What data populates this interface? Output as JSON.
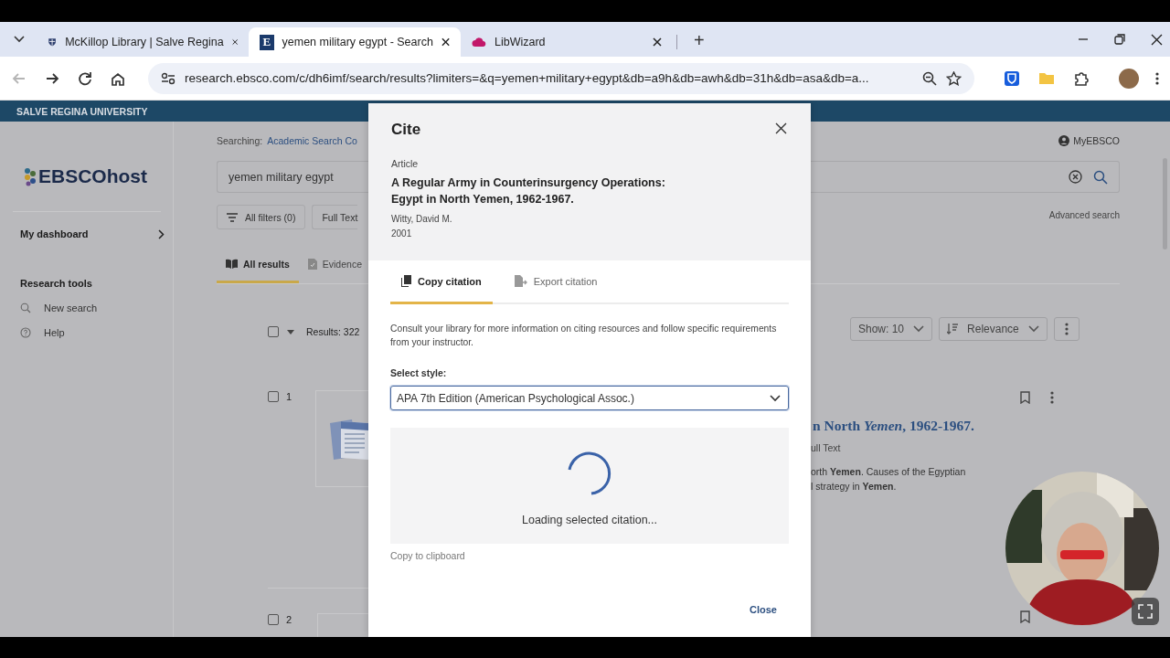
{
  "browser": {
    "tabs": [
      {
        "title": "McKillop Library | Salve Regina",
        "selected": false,
        "kind": "shield"
      },
      {
        "title": "yemen military egypt - Search",
        "selected": true,
        "kind": "letter",
        "favicon": "E"
      },
      {
        "title": "LibWizard",
        "selected": false,
        "kind": "cloud"
      }
    ],
    "new_tab": "+",
    "nav_buttons": [
      {
        "kind": "back",
        "disabled": true
      },
      {
        "kind": "forward",
        "disabled": false
      },
      {
        "kind": "reload",
        "disabled": false
      },
      {
        "kind": "home",
        "disabled": false
      }
    ],
    "url": "research.ebsco.com/c/dh6imf/search/results?limiters=&q=yemen+military+egypt&db=a9h&db=awh&db=31h&db=asa&db=a...",
    "extensions": [
      {
        "kind": "shield"
      },
      {
        "kind": "folder"
      },
      {
        "kind": "puzzle"
      }
    ]
  },
  "page": {
    "banner": "SALVE REGINA UNIVERSITY",
    "sidebar": {
      "logo": "EBSCOhost",
      "dashboard": "My dashboard",
      "section_title": "Research tools",
      "items": [
        {
          "kind": "search",
          "label": "New search"
        },
        {
          "kind": "help",
          "label": "Help"
        }
      ]
    },
    "search": {
      "searching_label": "Searching:",
      "database": "Academic Search Co",
      "query": "yemen military egypt"
    },
    "account": "MyEBSCO",
    "advanced_search": "Advanced search",
    "filters": [
      {
        "kind": "filter",
        "label": "All filters (0)"
      },
      {
        "kind": "plain",
        "label": "Full Text"
      }
    ],
    "result_tabs": [
      {
        "kind": "book",
        "label": "All results",
        "selected": true
      },
      {
        "kind": "evidence",
        "label": "Evidence",
        "selected": false
      }
    ],
    "select_all_checked": false,
    "results_count": "Results: 322",
    "show": "Show: 10",
    "sort": "Relevance",
    "results": [
      {
        "number": "1",
        "checked": false,
        "title_fragment": "n North *Yemen*, 1962-1967.",
        "availability_fragment": "ull Text",
        "abstract_fragments": [
          "orth **Yemen**. Causes of the Egyptian",
          "l strategy in **Yemen**."
        ]
      },
      {
        "number": "2",
        "checked": false
      }
    ]
  },
  "dialog": {
    "title": "Cite",
    "type_label": "Article",
    "article_title": "A Regular Army in Counterinsurgency Operations: Egypt in North Yemen, 1962-1967.",
    "author": "Witty, David M.",
    "year": "2001",
    "tabs": [
      {
        "kind": "copy",
        "label": "Copy citation",
        "selected": true
      },
      {
        "kind": "export",
        "label": "Export citation",
        "selected": false
      }
    ],
    "instructions": "Consult your library for more information on citing resources and follow specific requirements from your instructor.",
    "style_label": "Select style:",
    "style_value": "APA 7th Edition (American Psychological Assoc.)",
    "loading_text": "Loading selected citation...",
    "copy_link": "Copy to clipboard",
    "close_button": "Close"
  }
}
